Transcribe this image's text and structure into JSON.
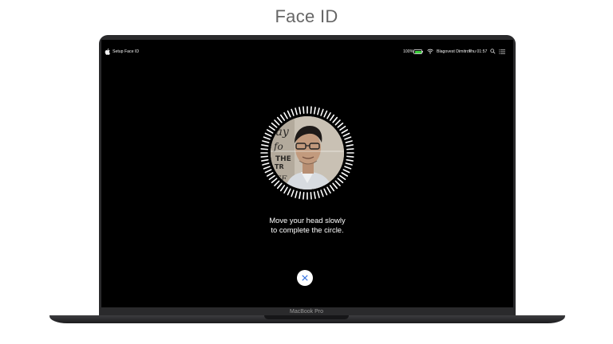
{
  "page": {
    "title": "Face ID",
    "model_label": "MacBook Pro"
  },
  "menubar": {
    "apple_icon": "apple-icon",
    "app_name": "Setup Face ID",
    "battery_percent": "100%",
    "battery_level": 1.0,
    "wifi_icon": "wifi-icon",
    "user_name": "Blagovest Dimitrov",
    "clock": "Thu 01:57",
    "search_icon": "search-icon",
    "list_icon": "list-icon"
  },
  "enrollment": {
    "instruction_line1": "Move your head slowly",
    "instruction_line2": "to complete the circle.",
    "cancel_icon": "close-icon"
  },
  "colors": {
    "screen_background": "#000000",
    "battery_fill": "#3fd13f",
    "cancel_icon": "#2f6fe0",
    "tick_marks": "#ffffff"
  }
}
